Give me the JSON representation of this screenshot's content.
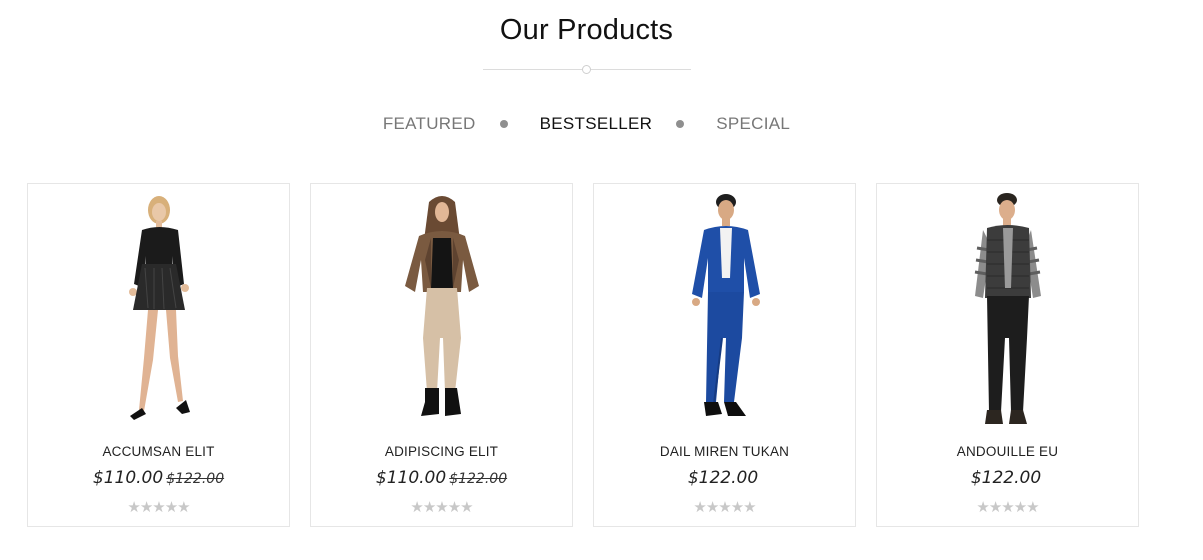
{
  "section": {
    "title": "Our Products"
  },
  "tabs": [
    {
      "label": "FEATURED",
      "active": false
    },
    {
      "label": "BESTSELLER",
      "active": true
    },
    {
      "label": "SPECIAL",
      "active": false
    }
  ],
  "products": [
    {
      "name": "ACCUMSAN ELIT",
      "price": "$110.00",
      "old_price": "$122.00",
      "rating": "★★★★★"
    },
    {
      "name": "ADIPISCING ELIT",
      "price": "$110.00",
      "old_price": "$122.00",
      "rating": "★★★★★"
    },
    {
      "name": "DAIL MIREN TUKAN",
      "price": "$122.00",
      "old_price": "",
      "rating": "★★★★★"
    },
    {
      "name": "ANDOUILLE EU",
      "price": "$122.00",
      "old_price": "",
      "rating": "★★★★★"
    }
  ],
  "colors": {
    "active_tab": "#111111",
    "inactive_tab": "#777777",
    "star_empty": "#c8c8c8",
    "card_border": "#e6e6e6"
  }
}
